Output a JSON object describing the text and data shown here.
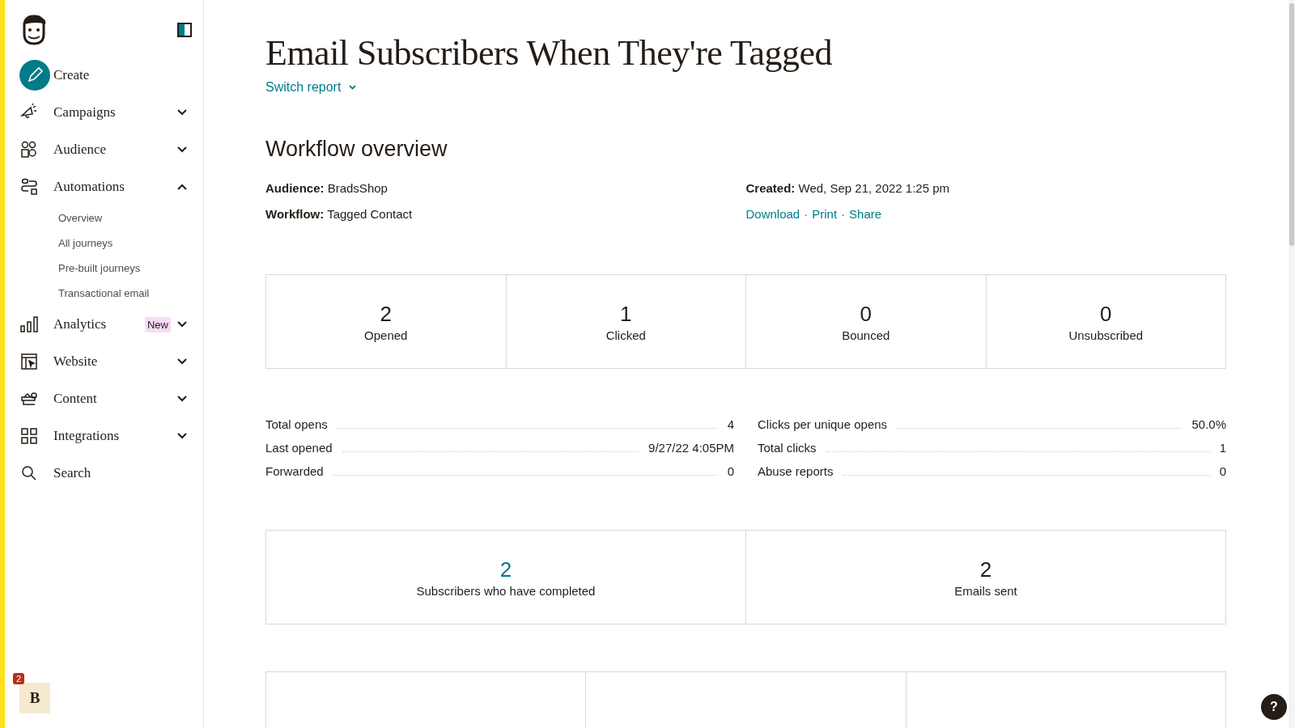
{
  "sidebar": {
    "items": [
      {
        "label": "Create",
        "kind": "create"
      },
      {
        "label": "Campaigns",
        "kind": "campaigns",
        "expanded": false
      },
      {
        "label": "Audience",
        "kind": "audience",
        "expanded": false
      },
      {
        "label": "Automations",
        "kind": "automations",
        "expanded": true,
        "children": [
          {
            "label": "Overview"
          },
          {
            "label": "All journeys"
          },
          {
            "label": "Pre-built journeys"
          },
          {
            "label": "Transactional email"
          }
        ]
      },
      {
        "label": "Analytics",
        "kind": "analytics",
        "badge": "New",
        "expanded": false
      },
      {
        "label": "Website",
        "kind": "website",
        "expanded": false
      },
      {
        "label": "Content",
        "kind": "content",
        "expanded": false
      },
      {
        "label": "Integrations",
        "kind": "integrations",
        "expanded": false
      },
      {
        "label": "Search",
        "kind": "search"
      }
    ],
    "account": {
      "initial": "B",
      "notifications": "2"
    }
  },
  "header": {
    "title": "Email Subscribers When They're Tagged",
    "switch_report": "Switch report"
  },
  "overview": {
    "heading": "Workflow overview",
    "details": [
      {
        "label": "Audience:",
        "value": "BradsShop"
      },
      {
        "label": "Workflow:",
        "value": "Tagged Contact"
      }
    ],
    "created": {
      "label": "Created:",
      "value": "Wed, Sep 21, 2022 1:25 pm"
    },
    "actions": [
      "Download",
      "Print",
      "Share"
    ],
    "separator": "·"
  },
  "stat_cards": [
    {
      "value": "2",
      "label": "Opened"
    },
    {
      "value": "1",
      "label": "Clicked"
    },
    {
      "value": "0",
      "label": "Bounced"
    },
    {
      "value": "0",
      "label": "Unsubscribed"
    }
  ],
  "metrics_left": [
    {
      "label": "Total opens",
      "value": "4"
    },
    {
      "label": "Last opened",
      "value": "9/27/22 4:05PM"
    },
    {
      "label": "Forwarded",
      "value": "0"
    }
  ],
  "metrics_right": [
    {
      "label": "Clicks per unique opens",
      "value": "50.0%"
    },
    {
      "label": "Total clicks",
      "value": "1"
    },
    {
      "label": "Abuse reports",
      "value": "0"
    }
  ],
  "summary_cards": [
    {
      "value": "2",
      "label": "Subscribers who have completed",
      "kind": "link"
    },
    {
      "value": "2",
      "label": "Emails sent",
      "kind": "plain"
    }
  ],
  "help": "?"
}
